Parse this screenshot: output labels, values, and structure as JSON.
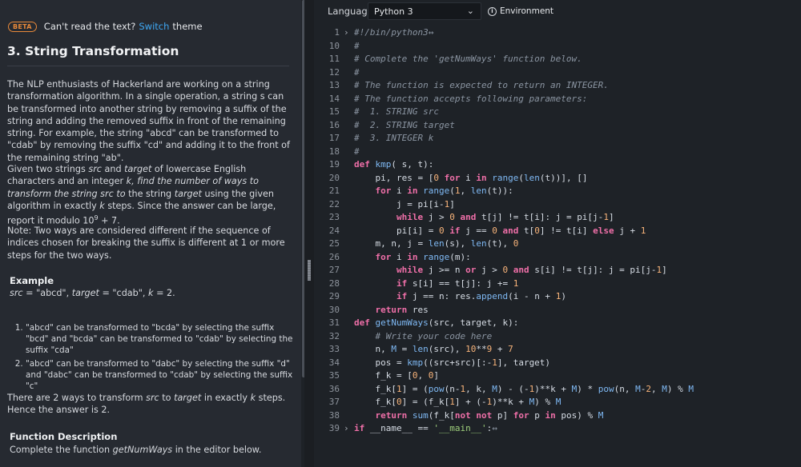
{
  "banner": {
    "badge": "BETA",
    "text1": "Can't read the text?",
    "link": "Switch",
    "text2": "theme"
  },
  "problem": {
    "title": "3. String Transformation",
    "para1": "The NLP enthusiasts of Hackerland are working on a string transformation algorithm. In a single operation, a string s can be transformed into another string by removing a suffix of the string and adding the removed suffix in front of the remaining string. For example, the string \"abcd\" can be transformed to \"cdab\" by removing the suffix \"cd\" and adding it to the front of the remaining string \"ab\".",
    "para2a": "Given two strings ",
    "para2_src": "src",
    "para2b": " and ",
    "para2_target": "target",
    "para2c": " of lowercase English characters and an integer ",
    "para2_k": "k",
    "para2d": ", find the number of ways to transform the string src to",
    "para2e": " the string ",
    "para2_target2": "target",
    "para2f": " using the given algorithm in exactly ",
    "para2_k2": "k",
    "para2g": " steps. Since the answer can be large, report it modulo 10",
    "para2_sup": "9",
    "para2h": " + 7.",
    "para3": "Note: Two ways are considered different if the sequence of indices chosen for breaking the suffix is different at 1 or more steps for the two ways.",
    "example_heading": "Example",
    "example_line_src": "src",
    "example_line_a": " = \"abcd\", ",
    "example_line_target": "target",
    "example_line_b": " = \"cdab\", ",
    "example_line_k": "k",
    "example_line_c": " = 2.",
    "steps": [
      "\"abcd\" can be transformed to \"bcda\" by selecting the suffix \"bcd\" and \"bcda\" can be transformed to \"cdab\" by selecting the suffix \"cda\"",
      "\"abcd\" can be transformed to \"dabc\" by selecting the suffix \"d\" and \"dabc\" can be transformed to \"cdab\" by selecting the suffix \"c\""
    ],
    "para4a": "There are 2 ways to transform ",
    "para4_src": "src",
    "para4b": " to ",
    "para4_target": "target",
    "para4c": " in exactly ",
    "para4_k": "k",
    "para4d": " steps. Hence the answer is 2.",
    "func_heading": "Function Description",
    "func_a": "Complete the function ",
    "func_name": "getNumWays",
    "func_b": " in the editor below."
  },
  "toolbar": {
    "language_label": "Language",
    "language_value": "Python 3",
    "environment_label": "Environment"
  },
  "editor": {
    "line_numbers": [
      "1",
      "10",
      "11",
      "12",
      "13",
      "14",
      "15",
      "16",
      "17",
      "18",
      "19",
      "20",
      "21",
      "22",
      "23",
      "24",
      "25",
      "26",
      "27",
      "28",
      "29",
      "30",
      "31",
      "32",
      "33",
      "34",
      "35",
      "36",
      "37",
      "38",
      "39"
    ],
    "lines": [
      "#!/bin/python3",
      "#",
      "# Complete the 'getNumWays' function below.",
      "#",
      "# The function is expected to return an INTEGER.",
      "# The function accepts following parameters:",
      "#  1. STRING src",
      "#  2. STRING target",
      "#  3. INTEGER k",
      "#",
      "def kmp( s, t):",
      "    pi, res = [0 for i in range(len(t))], []",
      "    for i in range(1, len(t)):",
      "        j = pi[i-1]",
      "        while j > 0 and t[j] != t[i]: j = pi[j-1]",
      "        pi[i] = 0 if j == 0 and t[0] != t[i] else j + 1",
      "    m, n, j = len(s), len(t), 0",
      "    for i in range(m):",
      "        while j >= n or j > 0 and s[i] != t[j]: j = pi[j-1]",
      "        if s[i] == t[j]: j += 1",
      "        if j == n: res.append(i - n + 1)",
      "    return res",
      "def getNumWays(src, target, k):",
      "    # Write your code here",
      "    n, M = len(src), 10**9 + 7",
      "    pos = kmp((src+src)[:-1], target)",
      "    f_k = [0, 0]",
      "    f_k[1] = (pow(n-1, k, M) - (-1)**k + M) * pow(n, M-2, M) % M",
      "    f_k[0] = (f_k[1] + (-1)**k + M) % M",
      "    return sum(f_k[not not p] for p in pos) % M",
      "if __name__ == '__main__':"
    ]
  }
}
